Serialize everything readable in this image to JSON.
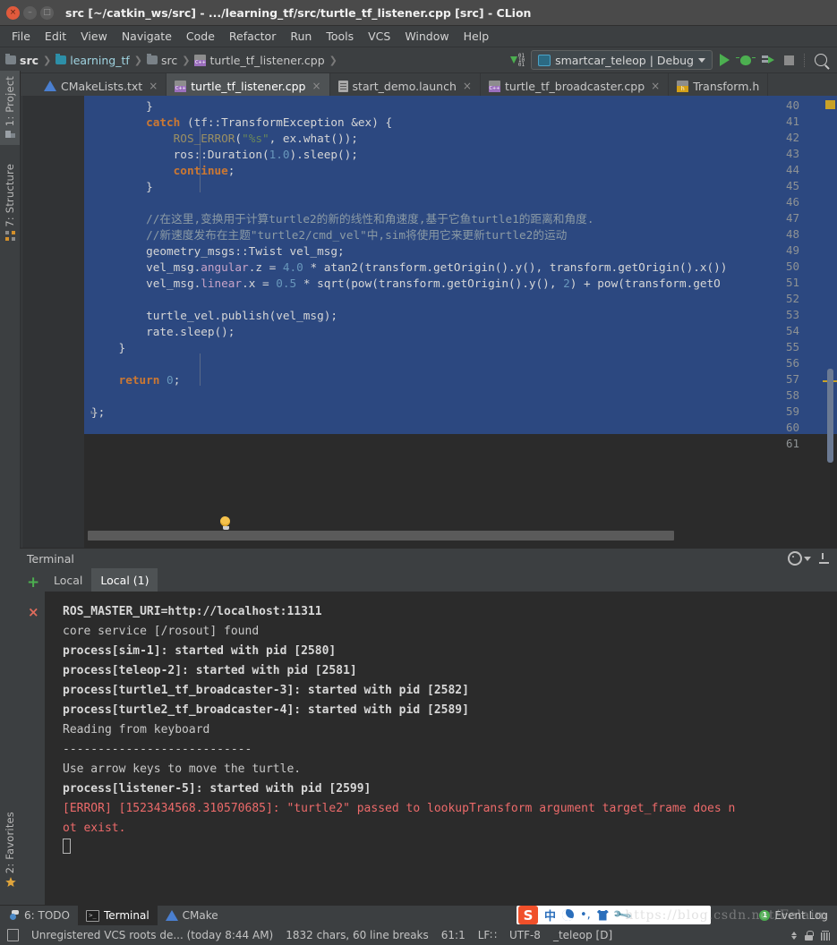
{
  "window": {
    "title": "src [~/catkin_ws/src] - .../learning_tf/src/turtle_tf_listener.cpp [src] - CLion",
    "close_glyph": "×",
    "min_glyph": "–",
    "max_glyph": "□"
  },
  "menu": [
    "File",
    "Edit",
    "View",
    "Navigate",
    "Code",
    "Refactor",
    "Run",
    "Tools",
    "VCS",
    "Window",
    "Help"
  ],
  "breadcrumb": [
    {
      "label": "src",
      "icon": "folder-icon",
      "style": "bold"
    },
    {
      "label": "learning_tf",
      "icon": "folder-icon-teal",
      "style": "cyan"
    },
    {
      "label": "src",
      "icon": "folder-icon",
      "style": "plain"
    },
    {
      "label": "turtle_tf_listener.cpp",
      "icon": "cpp-file-icon",
      "style": "plain"
    }
  ],
  "toolbar": {
    "run_config": "smartcar_teleop | Debug",
    "icons": [
      "sort-icon",
      "run-icon",
      "debug-icon",
      "run-with-coverage-icon",
      "stop-icon",
      "search-icon"
    ]
  },
  "editor_tabs": [
    {
      "label": "CMakeLists.txt",
      "icon": "cmake-icon",
      "active": false,
      "closable": true
    },
    {
      "label": "turtle_tf_listener.cpp",
      "icon": "cpp-file-icon",
      "active": true,
      "closable": true
    },
    {
      "label": "start_demo.launch",
      "icon": "launch-file-icon",
      "active": false,
      "closable": true
    },
    {
      "label": "turtle_tf_broadcaster.cpp",
      "icon": "cpp-file-icon",
      "active": false,
      "closable": true
    },
    {
      "label": "Transform.h",
      "icon": "header-file-icon",
      "active": false,
      "closable": false
    }
  ],
  "left_rail": [
    {
      "label": "1: Project",
      "icon": "project-icon",
      "selected": true
    },
    {
      "label": "7: Structure",
      "icon": "structure-icon",
      "selected": false
    },
    {
      "label": "2: Favorites",
      "icon": "star-icon",
      "selected": false
    }
  ],
  "code": {
    "first_line": 40,
    "lines": [
      {
        "n": 40,
        "text": "        }"
      },
      {
        "n": 41,
        "text": "        catch (tf::TransformException &ex) {"
      },
      {
        "n": 42,
        "text": "            ROS_ERROR(\"%s\", ex.what());"
      },
      {
        "n": 43,
        "text": "            ros::Duration(1.0).sleep();"
      },
      {
        "n": 44,
        "text": "            continue;"
      },
      {
        "n": 45,
        "text": "        }"
      },
      {
        "n": 46,
        "text": ""
      },
      {
        "n": 47,
        "text": "        //在这里,变换用于计算turtle2的新的线性和角速度,基于它鱼turtle1的距离和角度."
      },
      {
        "n": 48,
        "text": "        //新速度发布在主题\"turtle2/cmd_vel\"中,sim将使用它来更新turtle2的运动"
      },
      {
        "n": 49,
        "text": "        geometry_msgs::Twist vel_msg;"
      },
      {
        "n": 50,
        "text": "        vel_msg.angular.z = 4.0 * atan2(transform.getOrigin().y(), transform.getOrigin().x())"
      },
      {
        "n": 51,
        "text": "        vel_msg.linear.x = 0.5 * sqrt(pow(transform.getOrigin().y(), 2) + pow(transform.getO"
      },
      {
        "n": 52,
        "text": ""
      },
      {
        "n": 53,
        "text": "        turtle_vel.publish(vel_msg);"
      },
      {
        "n": 54,
        "text": "        rate.sleep();"
      },
      {
        "n": 55,
        "text": "    }"
      },
      {
        "n": 56,
        "text": ""
      },
      {
        "n": 57,
        "text": "    return 0;"
      },
      {
        "n": 58,
        "text": ""
      },
      {
        "n": 59,
        "text": "};"
      },
      {
        "n": 60,
        "text": ""
      },
      {
        "n": 61,
        "text": ""
      }
    ]
  },
  "terminal": {
    "title": "Terminal",
    "tabs": [
      {
        "label": "Local",
        "active": false
      },
      {
        "label": "Local (1)",
        "active": true
      }
    ],
    "add_glyph": "+",
    "close_glyph": "×",
    "output": [
      {
        "text": "ROS_MASTER_URI=http://localhost:11311",
        "style": "bold"
      },
      {
        "text": "",
        "style": "plain"
      },
      {
        "text": "core service [/rosout] found",
        "style": "plain"
      },
      {
        "text": "process[sim-1]: started with pid [2580]",
        "style": "bold"
      },
      {
        "text": "process[teleop-2]: started with pid [2581]",
        "style": "bold"
      },
      {
        "text": "process[turtle1_tf_broadcaster-3]: started with pid [2582]",
        "style": "bold"
      },
      {
        "text": "process[turtle2_tf_broadcaster-4]: started with pid [2589]",
        "style": "bold"
      },
      {
        "text": "Reading from keyboard",
        "style": "plain"
      },
      {
        "text": "---------------------------",
        "style": "plain"
      },
      {
        "text": "Use arrow keys to move the turtle.",
        "style": "plain"
      },
      {
        "text": "process[listener-5]: started with pid [2599]",
        "style": "bold"
      },
      {
        "text": "[ERROR] [1523434568.310570685]: \"turtle2\" passed to lookupTransform argument target_frame does n",
        "style": "error"
      },
      {
        "text": "ot exist.",
        "style": "error"
      }
    ]
  },
  "tool_windows": [
    {
      "label": "6: TODO",
      "icon": "todo-icon",
      "active": false
    },
    {
      "label": "Terminal",
      "icon": "terminal-icon",
      "active": true
    },
    {
      "label": "CMake",
      "icon": "cmake-icon",
      "active": false
    }
  ],
  "event_log": {
    "label": "Event Log",
    "badge": "1"
  },
  "status_bar": {
    "vcs_message": "Unregistered VCS roots de... (today 8:44 AM)",
    "chars": "1832 chars, 60 line breaks",
    "caret": "61:1",
    "line_sep": "LF∷",
    "encoding": "UTF-8",
    "context": "_teleop [D]"
  },
  "watermark": "https://blog.csdn.net/Felaim",
  "colors": {
    "accent_blue": "#2c4880",
    "keyword": "#cc7832",
    "number": "#6897bb",
    "string": "#6a8759",
    "comment": "#8c9ba5",
    "error_red": "#ec6a6a",
    "run_green": "#4caf50"
  }
}
